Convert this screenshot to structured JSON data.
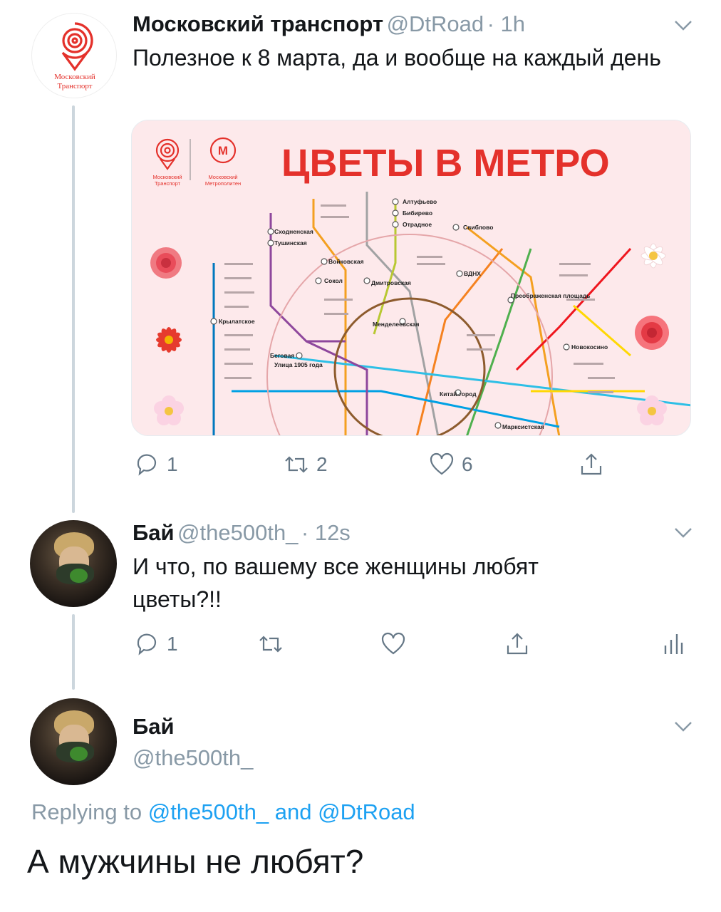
{
  "tweets": [
    {
      "author": "Московский транспорт",
      "handle": "@DtRoad",
      "time": "· 1h",
      "text": "Полезное к 8 марта, да и вообще на каждый день",
      "avatar_logo_line1": "Московский",
      "avatar_logo_line2": "Транспорт",
      "actions": {
        "reply": "1",
        "retweet": "2",
        "like": "6"
      },
      "media": {
        "title": "ЦВЕТЫ В МЕТРО",
        "logo1_line1": "Московский",
        "logo1_line2": "Транспорт",
        "logo2_line1": "Московский",
        "logo2_line2": "Метрополитен",
        "stations": [
          "Алтуфьево",
          "Бибирево",
          "Отрадное",
          "Свиблово",
          "Сходненская",
          "Тушинская",
          "Войковская",
          "Сокол",
          "Дмитровская",
          "ВДНХ",
          "Преображенская площадь",
          "Крылатское",
          "Менделеевская",
          "Новокосино",
          "Беговая",
          "Улица 1905 года",
          "Китай-город",
          "Марксистская"
        ]
      }
    },
    {
      "author": "Бай",
      "handle": "@the500th_",
      "time": "· 12s",
      "text_line1": "И что, по вашему все женщины любят",
      "text_line2": "цветы?!!",
      "actions": {
        "reply": "1"
      }
    }
  ],
  "reply_compose": {
    "author": "Бай",
    "handle": "@the500th_",
    "replying_prefix": "Replying to",
    "replying_mention1": "@the500th_",
    "replying_and": "and",
    "replying_mention2": "@DtRoad",
    "text": "А мужчины не любят?"
  },
  "colors": {
    "brand_red": "#e4312b",
    "link_blue": "#1da1f2",
    "muted_gray": "#8899a6",
    "thread_line": "#ccd6dd"
  },
  "icons": [
    "reply-icon",
    "retweet-icon",
    "like-icon",
    "share-icon",
    "analytics-icon",
    "chevron-down-icon"
  ]
}
